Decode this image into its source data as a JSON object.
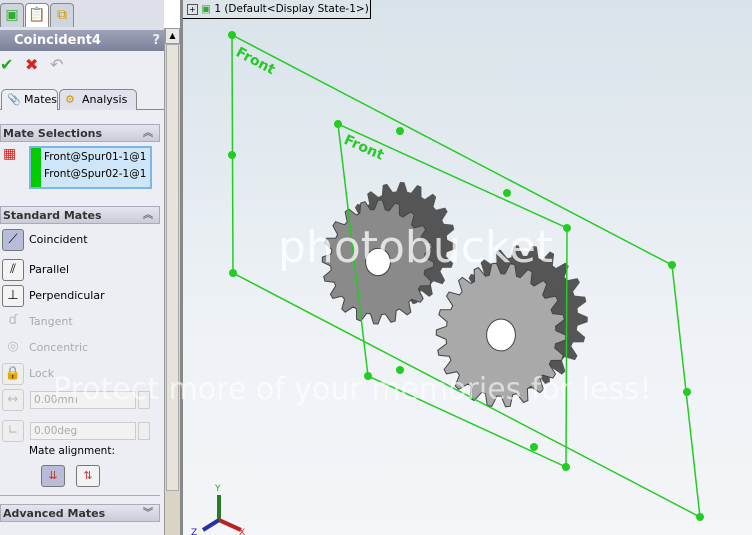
{
  "panel": {
    "top_tabs": [
      {
        "icon": "feature-manager-icon"
      },
      {
        "icon": "property-manager-icon"
      },
      {
        "icon": "configuration-manager-icon"
      }
    ],
    "title": "Coincident4",
    "help": "?",
    "actions": {
      "ok": "✔",
      "cancel": "✖",
      "undo": "↶"
    },
    "tabs": [
      {
        "label": "Mates",
        "active": true
      },
      {
        "label": "Analysis",
        "active": false
      }
    ],
    "mate_selections": {
      "header": "Mate Selections",
      "items": [
        "Front@Spur01-1@1",
        "Front@Spur02-1@1"
      ],
      "color": "#00cc00"
    },
    "standard_mates": {
      "header": "Standard Mates",
      "items": [
        {
          "label": "Coincident",
          "enabled": true,
          "selected": true
        },
        {
          "label": "Parallel",
          "enabled": true
        },
        {
          "label": "Perpendicular",
          "enabled": true
        },
        {
          "label": "Tangent",
          "enabled": false
        },
        {
          "label": "Concentric",
          "enabled": false
        },
        {
          "label": "Lock",
          "enabled": false
        }
      ],
      "distance": "0.00mm",
      "angle": "0.00deg",
      "alignment_label": "Mate alignment:"
    },
    "advanced_mates": {
      "header": "Advanced Mates"
    }
  },
  "viewport": {
    "tree_item": "1  (Default<Display State-1>)",
    "plane_labels": [
      "Front",
      "Front"
    ],
    "plane_color": "#22cc22",
    "triad": {
      "x": "X",
      "y": "Y",
      "z": "Z"
    },
    "watermark": {
      "brand": "photobucket",
      "slogan": "Protect more of your memories for less!"
    }
  }
}
